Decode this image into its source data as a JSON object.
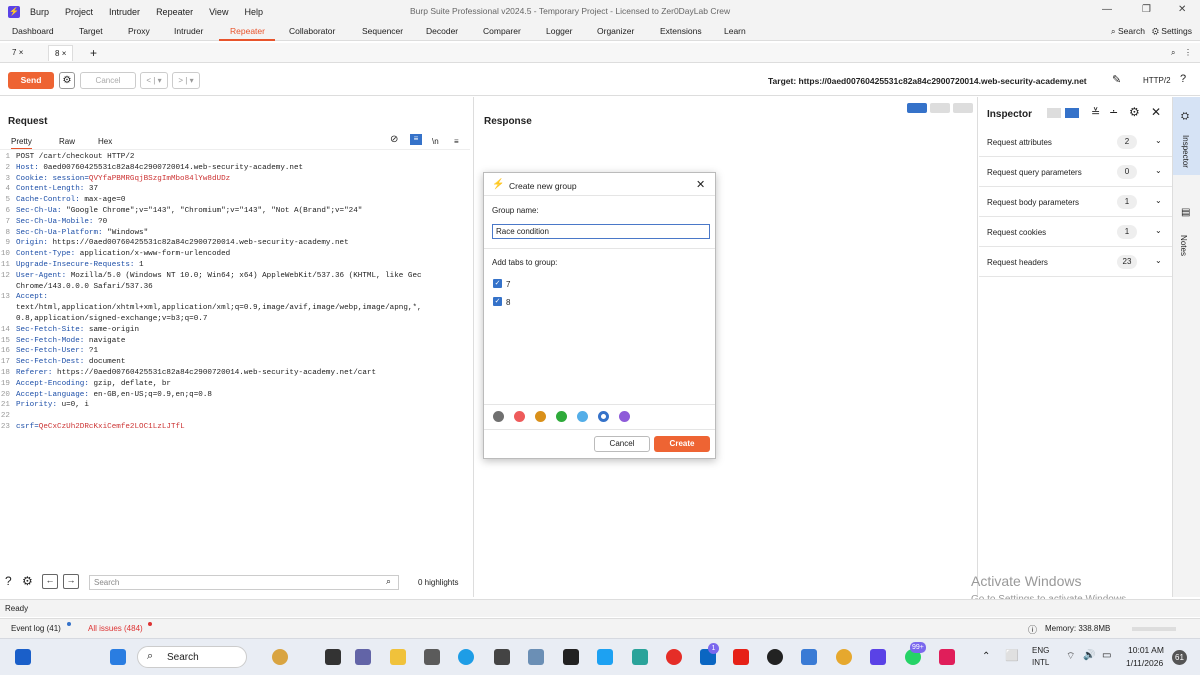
{
  "menubar": {
    "items": [
      "Burp",
      "Project",
      "Intruder",
      "Repeater",
      "View",
      "Help"
    ],
    "window_title": "Burp Suite Professional v2024.5 - Temporary Project - Licensed to Zer0DayLab Crew"
  },
  "main_tabs": [
    "Dashboard",
    "Target",
    "Proxy",
    "Intruder",
    "Repeater",
    "Collaborator",
    "Sequencer",
    "Decoder",
    "Comparer",
    "Logger",
    "Organizer",
    "Extensions",
    "Learn"
  ],
  "active_main_tab": "Repeater",
  "top_right": {
    "search": "Search",
    "settings": "Settings"
  },
  "sub_tabs": [
    "7",
    "8"
  ],
  "actionbar": {
    "send": "Send",
    "cancel": "Cancel",
    "target": "Target: https://0aed00760425531c82a84c2900720014.web-security-academy.net",
    "protocol": "HTTP/2"
  },
  "request": {
    "title": "Request",
    "tabs": [
      "Pretty",
      "Raw",
      "Hex"
    ],
    "newline_toggle": "\\n",
    "lines": [
      {
        "n": "1",
        "name": "",
        "value": "POST /cart/checkout HTTP/2"
      },
      {
        "n": "2",
        "name": "Host:",
        "value": " 0aed00760425531c82a84c2900720014.web-security-academy.net"
      },
      {
        "n": "3",
        "name": "Cookie:",
        "value": " session=QVYfaPBMRGqjBSzgImMbo84lYw8dUDz",
        "cookie": true
      },
      {
        "n": "4",
        "name": "Content-Length:",
        "value": " 37"
      },
      {
        "n": "5",
        "name": "Cache-Control:",
        "value": " max-age=0"
      },
      {
        "n": "6",
        "name": "Sec-Ch-Ua:",
        "value": " \"Google Chrome\";v=\"143\", \"Chromium\";v=\"143\", \"Not A(Brand\";v=\"24\""
      },
      {
        "n": "7",
        "name": "Sec-Ch-Ua-Mobile:",
        "value": " ?0"
      },
      {
        "n": "8",
        "name": "Sec-Ch-Ua-Platform:",
        "value": " \"Windows\""
      },
      {
        "n": "9",
        "name": "Origin:",
        "value": " https://0aed00760425531c82a84c2900720014.web-security-academy.net"
      },
      {
        "n": "10",
        "name": "Content-Type:",
        "value": " application/x-www-form-urlencoded"
      },
      {
        "n": "11",
        "name": "Upgrade-Insecure-Requests:",
        "value": " 1"
      },
      {
        "n": "12",
        "name": "User-Agent:",
        "value": " Mozilla/5.0 (Windows NT 10.0; Win64; x64) AppleWebKit/537.36 (KHTML, like Gec"
      },
      {
        "n": "",
        "name": "",
        "value": "Chrome/143.0.0.0 Safari/537.36"
      },
      {
        "n": "13",
        "name": "Accept:",
        "value": ""
      },
      {
        "n": "",
        "name": "",
        "value": "text/html,application/xhtml+xml,application/xml;q=0.9,image/avif,image/webp,image/apng,*,"
      },
      {
        "n": "",
        "name": "",
        "value": "0.8,application/signed-exchange;v=b3;q=0.7"
      },
      {
        "n": "14",
        "name": "Sec-Fetch-Site:",
        "value": " same-origin"
      },
      {
        "n": "15",
        "name": "Sec-Fetch-Mode:",
        "value": " navigate"
      },
      {
        "n": "16",
        "name": "Sec-Fetch-User:",
        "value": " ?1"
      },
      {
        "n": "17",
        "name": "Sec-Fetch-Dest:",
        "value": " document"
      },
      {
        "n": "18",
        "name": "Referer:",
        "value": " https://0aed00760425531c82a84c2900720014.web-security-academy.net/cart"
      },
      {
        "n": "19",
        "name": "Accept-Encoding:",
        "value": " gzip, deflate, br"
      },
      {
        "n": "20",
        "name": "Accept-Language:",
        "value": " en-GB,en-US;q=0.9,en;q=0.8"
      },
      {
        "n": "21",
        "name": "Priority:",
        "value": " u=0, i"
      },
      {
        "n": "22",
        "name": "",
        "value": ""
      },
      {
        "n": "23",
        "name": "",
        "value": "csrf=QeCxCzUh2DRcKxiCemfe2LOC1LzLJTfL",
        "body": true
      }
    ],
    "search_placeholder": "Search",
    "highlights": "0 highlights"
  },
  "response": {
    "title": "Response"
  },
  "inspector": {
    "title": "Inspector",
    "rows": [
      {
        "label": "Request attributes",
        "count": "2"
      },
      {
        "label": "Request query parameters",
        "count": "0"
      },
      {
        "label": "Request body parameters",
        "count": "1"
      },
      {
        "label": "Request cookies",
        "count": "1"
      },
      {
        "label": "Request headers",
        "count": "23"
      }
    ],
    "side_tabs": [
      "Inspector",
      "Notes"
    ]
  },
  "dialog": {
    "title": "Create new group",
    "group_name_label": "Group name:",
    "group_name_value": "Race condition",
    "add_tabs_label": "Add tabs to group:",
    "tabs": [
      "7",
      "8"
    ],
    "colors": [
      "#707070",
      "#ee5b5b",
      "#d9901a",
      "#2eaa3a",
      "#54aee8",
      "#3572c9",
      "#8e5bd9"
    ],
    "cancel": "Cancel",
    "create": "Create"
  },
  "status": {
    "ready": "Ready",
    "event_log": "Event log (41)",
    "all_issues": "All issues (484)",
    "memory": "Memory: 338.8MB"
  },
  "watermark": {
    "line1": "Activate Windows",
    "line2": "Go to Settings to activate Windows."
  },
  "taskbar": {
    "search": "Search",
    "lang1": "ENG",
    "lang2": "INTL",
    "time": "10:01 AM",
    "date": "1/11/2026",
    "notif": "61",
    "badge_linkedin": "1",
    "badge_whatsapp": "99+"
  }
}
